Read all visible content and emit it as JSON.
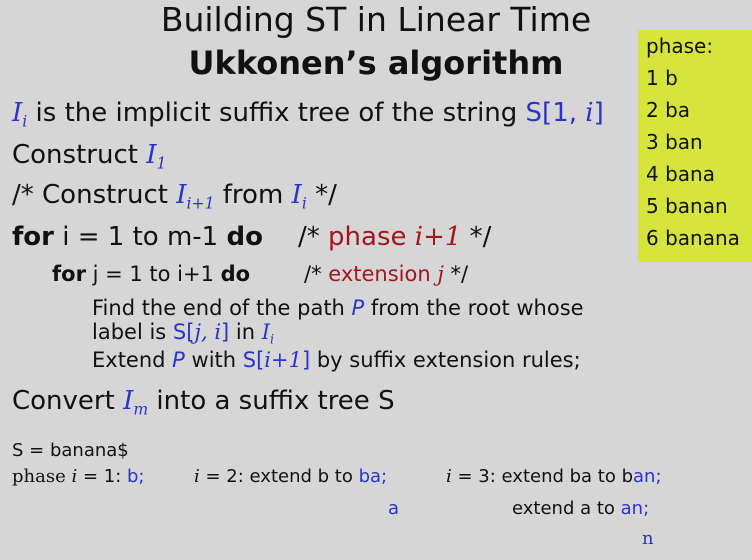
{
  "title": {
    "line1": "Building ST in Linear Time",
    "line2": "Ukkonen’s algorithm"
  },
  "phase_box": {
    "heading": "phase:",
    "items": [
      "1 b",
      "2 ba",
      "3 ban",
      "4 bana",
      "5 banan",
      "6 banana"
    ]
  },
  "lines": {
    "l1": {
      "I": "I",
      "sub": "i",
      "text": " is the implicit suffix tree of the string ",
      "S": "S[1, ",
      "i": "i",
      "close": "]"
    },
    "l2": {
      "text": "Construct ",
      "I": "I",
      "sub": "1"
    },
    "l3": {
      "pre": "/* Construct ",
      "I1": "I",
      "sub1": "i+1",
      "mid": " from ",
      "I2": "I",
      "sub2": "i",
      "post": " */"
    },
    "l4": {
      "for": "for",
      "range": " i = 1 to m-1 ",
      "do": "do",
      "comment_pre": "/* ",
      "phase": "phase ",
      "phase_var": "i+1",
      "comment_post": " */"
    },
    "l5": {
      "for": "for",
      "range": " j = 1 to i+1 ",
      "do": "do",
      "comment_pre": "/* ",
      "ext": "extension ",
      "ext_var": "j",
      "comment_post": " */"
    },
    "l6": {
      "a": "Find the end of the path ",
      "P": "P",
      "b": " from the root  whose"
    },
    "l7": {
      "a": "label is ",
      "S": "S[",
      "j": "j, i",
      "close": "]",
      "b": " in ",
      "I": "I",
      "sub": "i"
    },
    "l8": {
      "a": "Extend ",
      "P": "P",
      "b": " with ",
      "S": "S[",
      "iv": "i+1",
      "close": "]",
      "c": " by suffix extension rules;"
    },
    "l9": {
      "a": "Convert ",
      "I": "I",
      "sub": "m",
      "b": "  into a suffix tree S"
    }
  },
  "example": {
    "s": "S = banana$",
    "phase_label": "phase ",
    "i": "i",
    "eq1": " = 1: ",
    "b": "b;",
    "i2": "i",
    "eq2": " = 2: extend b to ",
    "ba": "ba;",
    "i3": "i",
    "eq3": " = 3: extend ba to b",
    "an1": "an;",
    "a": "a",
    "ext_a": "extend a to ",
    "an2": "an;",
    "n": "n"
  },
  "colors": {
    "background": "#d6d6d6",
    "highlight": "#d7e43c",
    "blue": "#2a35c8",
    "red": "#a11620"
  }
}
